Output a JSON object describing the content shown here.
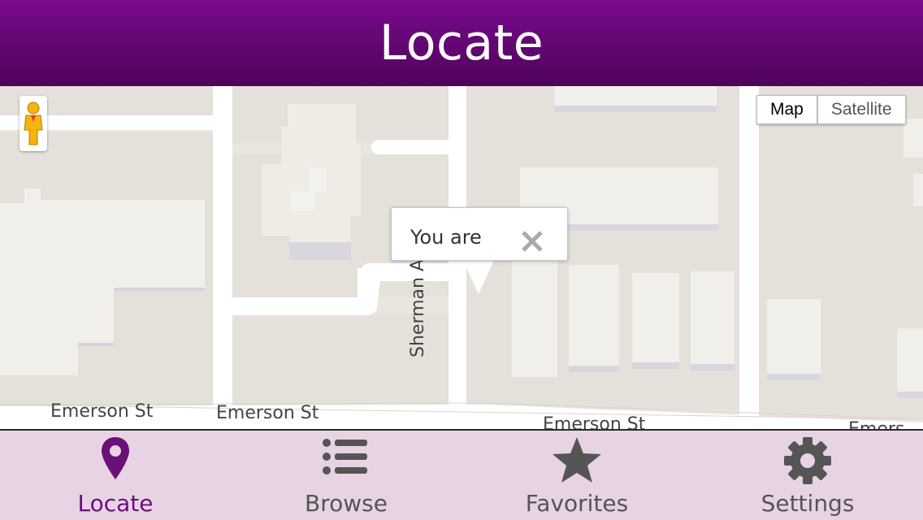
{
  "header": {
    "title": "Locate"
  },
  "map": {
    "map_type_options": [
      "Map",
      "Satellite"
    ],
    "selected_map_type": "Map",
    "info_bubble_text": "You are",
    "street_labels": {
      "emerson_1": "Emerson St",
      "emerson_2": "Emerson St",
      "emerson_3": "Emerson St",
      "emerson_4": "Emers",
      "sherman": "Sherman Ave"
    }
  },
  "tabs": [
    {
      "label": "Locate",
      "icon": "map-pin-icon",
      "active": true
    },
    {
      "label": "Browse",
      "icon": "list-icon",
      "active": false
    },
    {
      "label": "Favorites",
      "icon": "star-icon",
      "active": false
    },
    {
      "label": "Settings",
      "icon": "gear-icon",
      "active": false
    }
  ],
  "colors": {
    "header": "#6a0a7c",
    "tabbar": "#e8d3e5",
    "active_tab": "#6a1077",
    "inactive_tab": "#555555"
  }
}
